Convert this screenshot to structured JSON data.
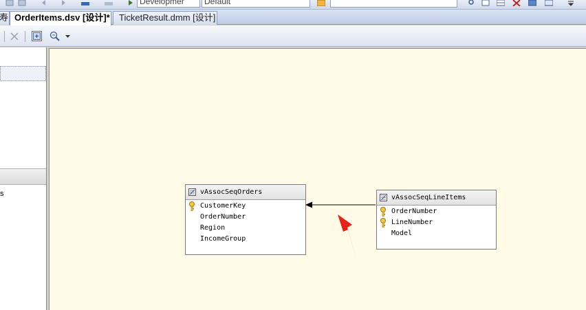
{
  "toolbar_top": {
    "combo_config": "Developmer",
    "combo_platform": "Default"
  },
  "tabs": [
    {
      "label": "OrderItems.dsv [设计]*",
      "active": true
    },
    {
      "label": "TicketResult.dmm [设计]",
      "active": false
    }
  ],
  "left_tab_glyph": "寿",
  "left_panel": {
    "fragment_text": "s"
  },
  "tables": [
    {
      "name": "vAssocSeqOrders",
      "columns": [
        {
          "name": "CustomerKey",
          "is_key": true
        },
        {
          "name": "OrderNumber",
          "is_key": false
        },
        {
          "name": "Region",
          "is_key": false
        },
        {
          "name": "IncomeGroup",
          "is_key": false
        }
      ]
    },
    {
      "name": "vAssocSeqLineItems",
      "columns": [
        {
          "name": "OrderNumber",
          "is_key": true
        },
        {
          "name": "LineNumber",
          "is_key": true
        },
        {
          "name": "Model",
          "is_key": false
        }
      ]
    }
  ],
  "colors": {
    "canvas_bg": "#fffbe7",
    "annotation_arrow": "#e8211b",
    "key_icon": "#d7a21c"
  }
}
